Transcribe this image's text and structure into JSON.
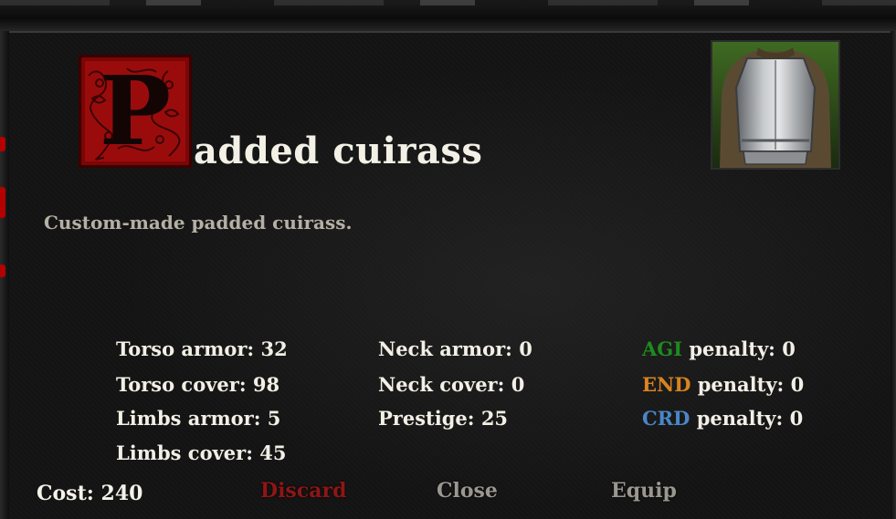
{
  "item": {
    "initial_letter": "P",
    "title_rest": "added cuirass",
    "description": "Custom-made padded cuirass.",
    "image_icon": "steel-cuirass-icon"
  },
  "stats": {
    "col1": [
      "Torso armor: 32",
      "Torso cover: 98",
      "Limbs armor: 5",
      "Limbs cover: 45"
    ],
    "col2": [
      "Neck armor: 0",
      "Neck cover: 0",
      "Prestige: 25"
    ],
    "penalties": [
      {
        "tag": "AGI",
        "text": " penalty: 0",
        "color": "#1f8a1f"
      },
      {
        "tag": "END",
        "text": " penalty: 0",
        "color": "#d9841e"
      },
      {
        "tag": "CRD",
        "text": " penalty: 0",
        "color": "#4a86c8"
      }
    ]
  },
  "footer": {
    "cost": "Cost: 240",
    "discard": "Discard",
    "close": "Close",
    "equip": "Equip"
  },
  "colors": {
    "discard": "#8e1616",
    "close": "#9a9790",
    "equip": "#9a9790",
    "initial_bg": "#9a0c0c"
  }
}
